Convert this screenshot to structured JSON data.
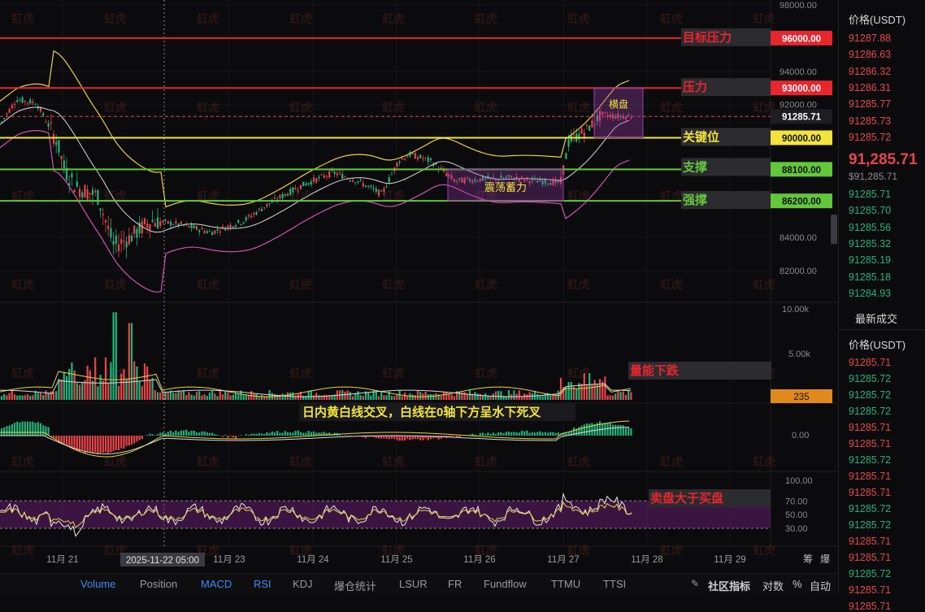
{
  "watermark": "虹虎",
  "price_axis": {
    "ticks": [
      "98000.00",
      "94000.00",
      "92000.00",
      "84000.00",
      "82000.00"
    ],
    "levels": [
      {
        "label": "96000.00",
        "price": 96000,
        "color": "#e8262e",
        "text_color": "#ffffff"
      },
      {
        "label": "93000.00",
        "price": 93000,
        "color": "#e8262e",
        "text_color": "#ffffff"
      },
      {
        "label": "91285.71",
        "price": 91285.71,
        "color": "#1a1a1e",
        "text_color": "#ffffff",
        "dashed": true
      },
      {
        "label": "90000.00",
        "price": 90000,
        "color": "#f2e43c",
        "text_color": "#111111"
      },
      {
        "label": "88100.00",
        "price": 88100,
        "color": "#62c73a",
        "text_color": "#111111"
      },
      {
        "label": "86200.00",
        "price": 86200,
        "color": "#62c73a",
        "text_color": "#111111"
      }
    ]
  },
  "annotations": {
    "target_pressure": "目标压力",
    "pressure": "压力",
    "key_level": "关键位",
    "support": "支撑",
    "strong_support": "强撑",
    "sideways": "横盘",
    "consolidation": "震荡蓄力",
    "volume_drop": "量能下跌",
    "macd_note": "日内黄白线交叉，白线在0轴下方呈水下死叉",
    "rsi_note": "卖盘大于买盘"
  },
  "volume_axis": {
    "ticks": [
      "10.00k",
      "5.00k"
    ],
    "current": "235"
  },
  "macd_axis": {
    "ticks": [
      "0.00"
    ]
  },
  "rsi_axis": {
    "ticks": [
      "100.00",
      "70.00",
      "50.00",
      "30.00"
    ]
  },
  "x_axis": {
    "labels": [
      "11月 21",
      "11月 23",
      "11月 24",
      "11月 25",
      "11月 26",
      "11月 27",
      "11月 28",
      "11月 29"
    ],
    "crosshair_label": "2025-11-22 05:00",
    "corner": [
      "筹",
      "爆"
    ]
  },
  "toolbar": {
    "items": [
      {
        "label": "Volume",
        "active": true
      },
      {
        "label": "Position",
        "active": false
      },
      {
        "label": "MACD",
        "active": true
      },
      {
        "label": "RSI",
        "active": true
      },
      {
        "label": "KDJ",
        "active": false
      },
      {
        "label": "爆仓统计",
        "active": false
      },
      {
        "label": "LSUR",
        "active": false
      },
      {
        "label": "FR",
        "active": false
      },
      {
        "label": "Fundflow",
        "active": false
      },
      {
        "label": "TTMU",
        "active": false
      },
      {
        "label": "TTSI",
        "active": false
      }
    ],
    "community": "社区指标",
    "log": "对数",
    "pct": "%",
    "auto": "自动"
  },
  "side": {
    "price_header": "价格(USDT)",
    "asks": [
      "91287.88",
      "91286.63",
      "91286.32",
      "91286.31",
      "91285.77",
      "91285.73",
      "91285.72"
    ],
    "last_price": "91,285.71",
    "last_price_sub": "$91,285.71",
    "bids": [
      "91285.71",
      "91285.70",
      "91285.56",
      "91285.32",
      "91285.19",
      "91285.18",
      "91284.93"
    ],
    "trades_title": "最新成交",
    "trades_header": "价格(USDT)",
    "trades": [
      {
        "p": "91285.71",
        "c": "red"
      },
      {
        "p": "91285.72",
        "c": "green"
      },
      {
        "p": "91285.72",
        "c": "green"
      },
      {
        "p": "91285.72",
        "c": "green"
      },
      {
        "p": "91285.71",
        "c": "red"
      },
      {
        "p": "91285.71",
        "c": "red"
      },
      {
        "p": "91285.72",
        "c": "green"
      },
      {
        "p": "91285.71",
        "c": "red"
      },
      {
        "p": "91285.71",
        "c": "red"
      },
      {
        "p": "91285.72",
        "c": "green"
      },
      {
        "p": "91285.72",
        "c": "green"
      },
      {
        "p": "91285.71",
        "c": "red"
      },
      {
        "p": "91285.71",
        "c": "red"
      },
      {
        "p": "91285.72",
        "c": "green"
      },
      {
        "p": "91285.71",
        "c": "red"
      },
      {
        "p": "91285.71",
        "c": "red"
      }
    ]
  },
  "colors": {
    "up": "#22b37a",
    "down": "#e8454a",
    "bg": "#0b0b0d",
    "purple_box": "#9d3fb0"
  }
}
